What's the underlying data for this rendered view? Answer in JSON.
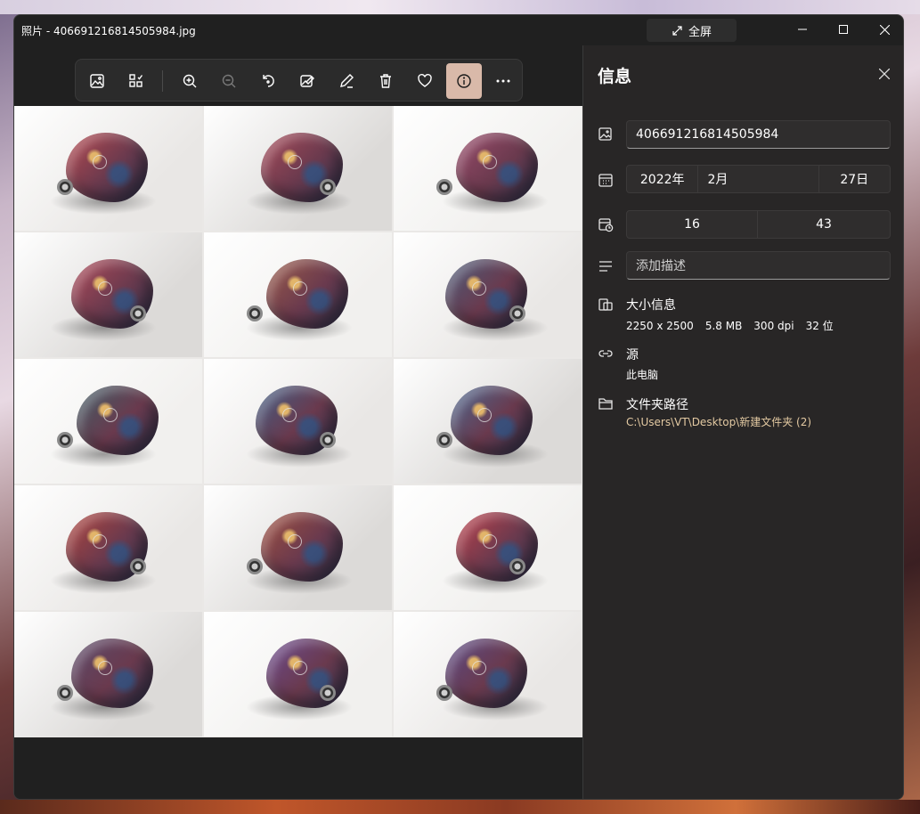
{
  "window": {
    "title": "照片 - 406691216814505984.jpg",
    "fullscreen_label": "全屏",
    "fullscreen_icon": "expand-arrows-icon",
    "controls": [
      "minimize-icon",
      "maximize-icon",
      "close-icon"
    ]
  },
  "toolbar": {
    "buttons": [
      {
        "name": "view-image-icon",
        "enabled": true
      },
      {
        "name": "add-to-album-icon",
        "enabled": true
      },
      {
        "name": "zoom-in-icon",
        "enabled": true
      },
      {
        "name": "zoom-out-icon",
        "enabled": false
      },
      {
        "name": "rotate-icon",
        "enabled": true
      },
      {
        "name": "edit-image-icon",
        "enabled": true
      },
      {
        "name": "draw-icon",
        "enabled": true
      },
      {
        "name": "delete-icon",
        "enabled": true
      },
      {
        "name": "favorite-icon",
        "enabled": true
      },
      {
        "name": "info-icon",
        "enabled": true,
        "active": true
      },
      {
        "name": "more-icon",
        "enabled": true
      }
    ],
    "active_color": "#d9b9a9"
  },
  "image_grid": {
    "rows": 5,
    "columns": 3,
    "description_colors": [
      [
        "#b8484e",
        "#a84a58",
        "#9a4a6a"
      ],
      [
        "#b04a58",
        "#9a5a48",
        "#4a5c7a"
      ],
      [
        "#3e5e66",
        "#3f5f86",
        "#4a6a92"
      ],
      [
        "#b4443c",
        "#a0503e",
        "#c0404a"
      ],
      [
        "#5a4a6a",
        "#6a4a90",
        "#5a4a86"
      ]
    ]
  },
  "info_panel": {
    "title": "信息",
    "close_icon": "close-icon",
    "filename": "406691216814505984",
    "date": {
      "year": "2022年",
      "month": "2月",
      "day": "27日"
    },
    "time": {
      "hour": "16",
      "minute": "43"
    },
    "description_placeholder": "添加描述",
    "size_info": {
      "label": "大小信息",
      "dimensions": "2250 x 2500",
      "filesize": "5.8 MB",
      "dpi": "300 dpi",
      "bitdepth": "32 位"
    },
    "source": {
      "label": "源",
      "value": "此电脑"
    },
    "folder": {
      "label": "文件夹路径",
      "path": "C:\\Users\\VT\\Desktop\\新建文件夹 (2)"
    },
    "link_color": "#e3c9a2"
  }
}
